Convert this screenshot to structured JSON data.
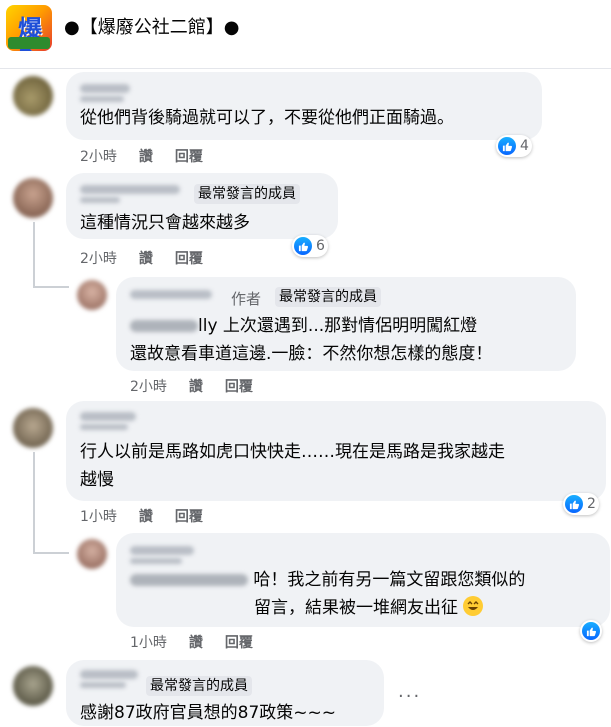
{
  "group": {
    "logo_text": "爆2公",
    "title": "●【爆廢公社二館】●"
  },
  "comments": [
    {
      "text_lines": [
        "從他們背後騎過就可以了，不要從他們正面騎過。"
      ],
      "time": "2小時",
      "like_label": "讚",
      "reply_label": "回覆",
      "reaction_count": "4"
    },
    {
      "badge": "最常發言的成員",
      "text_lines": [
        "這種情況只會越來越多"
      ],
      "time": "2小時",
      "like_label": "讚",
      "reply_label": "回覆",
      "reaction_count": "6"
    },
    {
      "author_tag": "作者",
      "badge": "最常發言的成員",
      "mention_suffix": "lly",
      "text_lines": [
        "上次還遇到...那對情侶明明闖紅燈",
        "還故意看車道這邊.一臉：不然你想怎樣的態度！"
      ],
      "time": "2小時",
      "like_label": "讚",
      "reply_label": "回覆"
    },
    {
      "text_lines": [
        "行人以前是馬路如虎口快快走……現在是馬路是我家越走",
        "越慢"
      ],
      "time": "1小時",
      "like_label": "讚",
      "reply_label": "回覆",
      "reaction_count": "2"
    },
    {
      "text_lines": [
        "哈！我之前有另一篇文留跟您類似的",
        "留言，結果被一堆網友出征"
      ],
      "time": "1小時",
      "like_label": "讚",
      "reply_label": "回覆"
    },
    {
      "badge": "最常發言的成員",
      "text_lines": [
        "感謝87政府官員想的87政策~~~"
      ],
      "more_label": "···"
    }
  ],
  "colors": {
    "bubble": "#f0f2f5",
    "meta_text": "#65676b",
    "like_blue": "#0866ff",
    "badge_bg": "#e4e6eb"
  },
  "icons": {
    "like": "like-icon",
    "emoji": "laughing-emoji-icon",
    "more": "more-options-icon"
  }
}
